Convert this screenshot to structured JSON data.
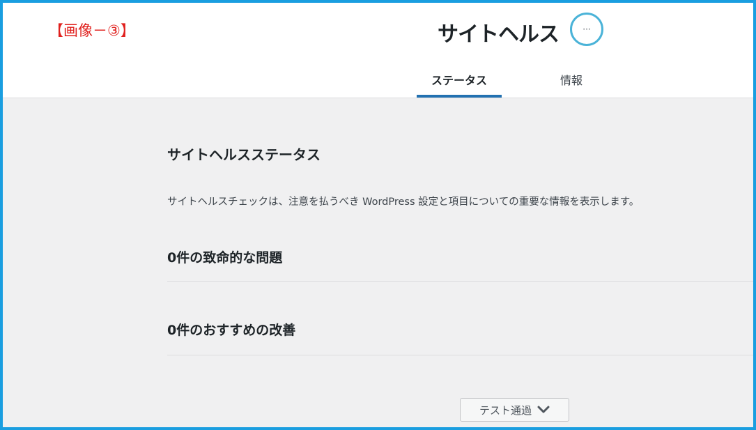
{
  "annotation": {
    "label": "【画像－③】",
    "color": "#e0201d"
  },
  "header": {
    "title": "サイトヘルス",
    "health_indicator": "···"
  },
  "tabs": [
    {
      "label": "ステータス",
      "active": true
    },
    {
      "label": "情報",
      "active": false
    }
  ],
  "main": {
    "section_title": "サイトヘルスステータス",
    "description": "サイトヘルスチェックは、注意を払うべき WordPress 設定と項目についての重要な情報を表示します。",
    "critical_issues_title": "0件の致命的な問題",
    "recommended_improvements_title": "0件のおすすめの改善",
    "passed_tests_button": "テスト通過"
  },
  "colors": {
    "frame_border": "#1a9ee0",
    "active_tab_underline": "#2271b1",
    "health_circle": "#4ab3d8",
    "content_background": "#f0f0f1"
  },
  "icons": {
    "passed_tests_toggle": "chevron-down-icon"
  }
}
